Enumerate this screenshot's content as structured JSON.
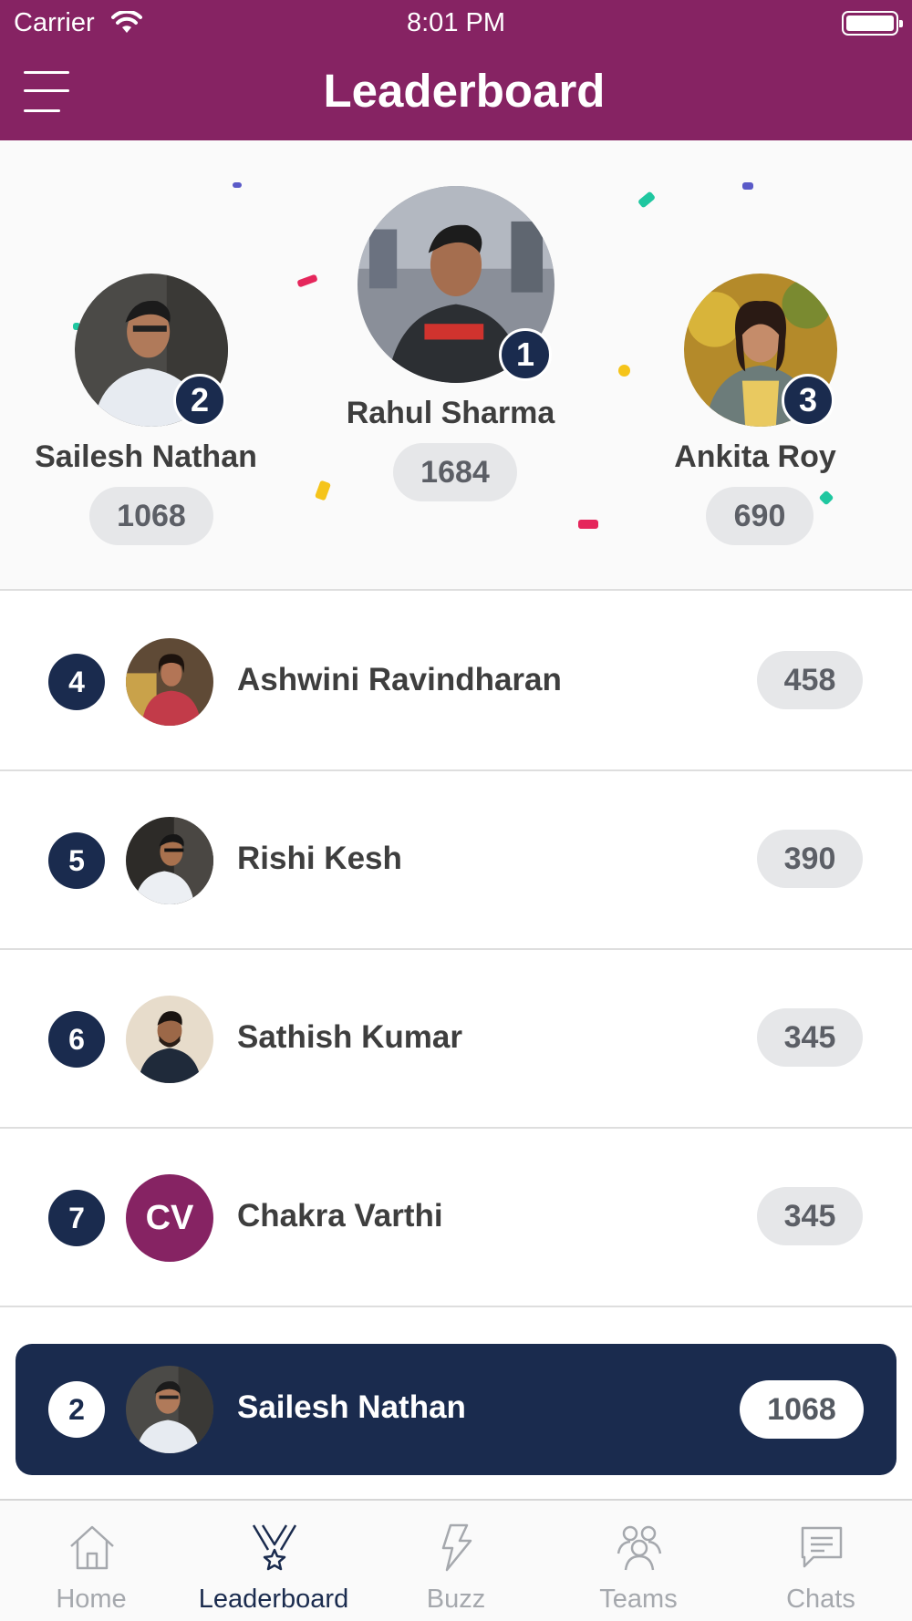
{
  "status_bar": {
    "carrier": "Carrier",
    "time": "8:01 PM"
  },
  "header": {
    "title": "Leaderboard"
  },
  "podium": [
    {
      "rank": "1",
      "name": "Rahul Sharma",
      "score": "1684"
    },
    {
      "rank": "2",
      "name": "Sailesh Nathan",
      "score": "1068"
    },
    {
      "rank": "3",
      "name": "Ankita Roy",
      "score": "690"
    }
  ],
  "list": [
    {
      "rank": "4",
      "name": "Ashwini Ravindharan",
      "score": "458"
    },
    {
      "rank": "5",
      "name": "Rishi Kesh",
      "score": "390"
    },
    {
      "rank": "6",
      "name": "Sathish Kumar",
      "score": "345"
    },
    {
      "rank": "7",
      "name": "Chakra Varthi",
      "score": "345",
      "initials": "CV"
    }
  ],
  "current_user": {
    "rank": "2",
    "name": "Sailesh Nathan",
    "score": "1068"
  },
  "tabs": [
    {
      "label": "Home",
      "icon": "home-icon"
    },
    {
      "label": "Leaderboard",
      "icon": "medal-icon",
      "active": true
    },
    {
      "label": "Buzz",
      "icon": "lightning-icon"
    },
    {
      "label": "Teams",
      "icon": "teams-icon"
    },
    {
      "label": "Chats",
      "icon": "chat-icon"
    }
  ],
  "colors": {
    "brand": "#862363",
    "navy": "#1a2b4e",
    "pill": "#e6e7e9"
  }
}
